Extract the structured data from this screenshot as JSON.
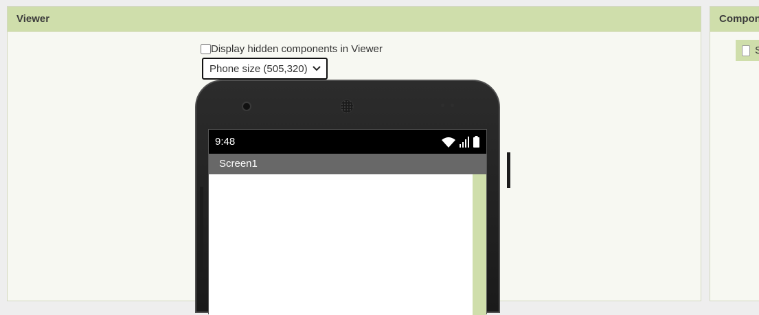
{
  "viewer": {
    "title": "Viewer",
    "hidden_components_label": "Display hidden components in Viewer",
    "size_select": {
      "selected": "Phone size (505,320)"
    }
  },
  "phone": {
    "status_bar": {
      "time": "9:48",
      "icons": [
        "wifi-icon",
        "signal-icon",
        "battery-icon"
      ]
    },
    "screen_title": "Screen1"
  },
  "components": {
    "title": "Compon",
    "tree": [
      {
        "label": "S",
        "icon": "screen-icon"
      }
    ]
  },
  "colors": {
    "panel_header": "#cfdeab",
    "panel_background": "#f7f8f2",
    "title_bar": "#686868",
    "status_bar": "#000000"
  }
}
